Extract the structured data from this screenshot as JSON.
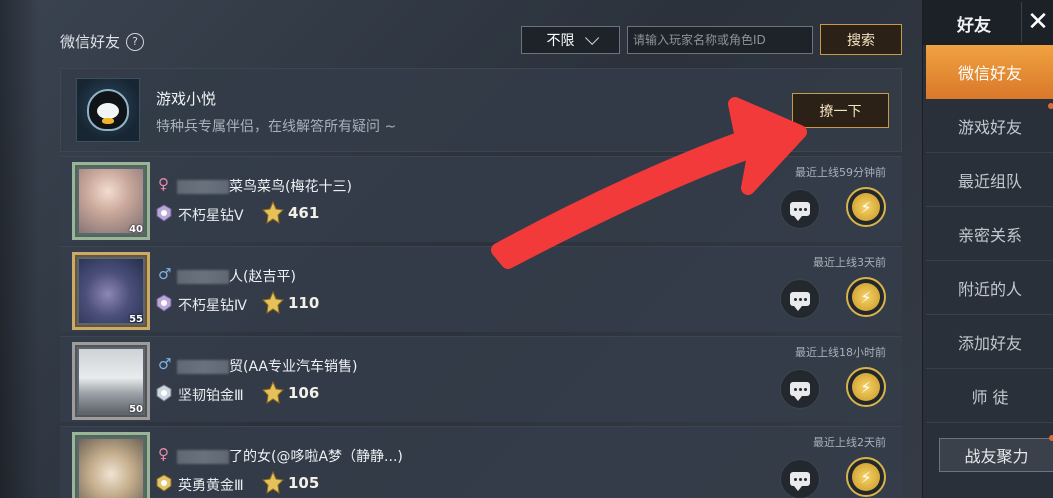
{
  "header": {
    "section_title": "微信好友",
    "help_icon_label": "?",
    "filter_value": "不限",
    "search_placeholder": "请输入玩家名称或角色ID",
    "search_button": "搜索"
  },
  "assistant": {
    "name": "游戏小悦",
    "desc": "特种兵专属伴侣，在线解答所有疑问 ~",
    "poke_button": "撩一下"
  },
  "friends": [
    {
      "gender": "♀",
      "name_suffix": "菜鸟菜鸟(梅花十三)",
      "level": "40",
      "rank": "不朽星钻Ⅴ",
      "tier_value": "461",
      "last_online": "最近上线59分钟前"
    },
    {
      "gender": "♂",
      "name_suffix": "人(赵吉平)",
      "level": "55",
      "rank": "不朽星钻Ⅳ",
      "tier_value": "110",
      "last_online": "最近上线3天前"
    },
    {
      "gender": "♂",
      "name_suffix": "贸(AA专业汽车销售)",
      "level": "50",
      "rank": "坚韧铂金Ⅲ",
      "tier_value": "106",
      "last_online": "最近上线18小时前"
    },
    {
      "gender": "♀",
      "name_suffix": "了的女(@哆啦A梦（静静...)",
      "level": "",
      "rank": "英勇黄金Ⅲ",
      "tier_value": "105",
      "last_online": "最近上线2天前"
    }
  ],
  "sidebar": {
    "title": "好友",
    "close_glyph": "✕",
    "items": [
      {
        "label": "微信好友"
      },
      {
        "label": "游戏好友"
      },
      {
        "label": "最近组队"
      },
      {
        "label": "亲密关系"
      },
      {
        "label": "附近的人"
      },
      {
        "label": "添加好友"
      },
      {
        "label": "师 徒"
      }
    ],
    "bottom_button": "战友聚力"
  },
  "colors": {
    "accent_orange": "#e08a30",
    "gold_border": "#c69a4a",
    "arrow_red": "#f23a3a"
  }
}
